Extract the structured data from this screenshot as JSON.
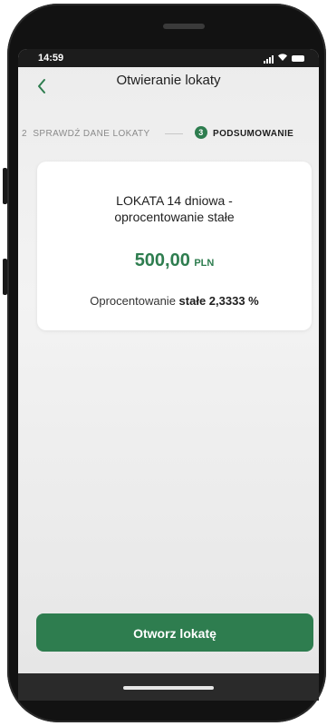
{
  "status": {
    "time": "14:59"
  },
  "header": {
    "title": "Otwieranie lokaty"
  },
  "steps": {
    "previous_number": "2",
    "previous_label": "SPRAWDŹ DANE LOKATY",
    "current_number": "3",
    "current_label": "PODSUMOWANIE"
  },
  "summary": {
    "title_line1": "LOKATA 14 dniowa -",
    "title_line2": "oprocentowanie stałe",
    "amount": "500,00",
    "currency": "PLN",
    "rate_prefix": "Oprocentowanie",
    "rate_value": "stałe 2,3333 %"
  },
  "actions": {
    "open_deposit": "Otworz lokatę"
  },
  "colors": {
    "accent": "#2e7d4f"
  },
  "icons": {
    "back": "chevron-left-icon",
    "signal": "signal-icon",
    "wifi": "wifi-icon",
    "battery": "battery-icon"
  }
}
